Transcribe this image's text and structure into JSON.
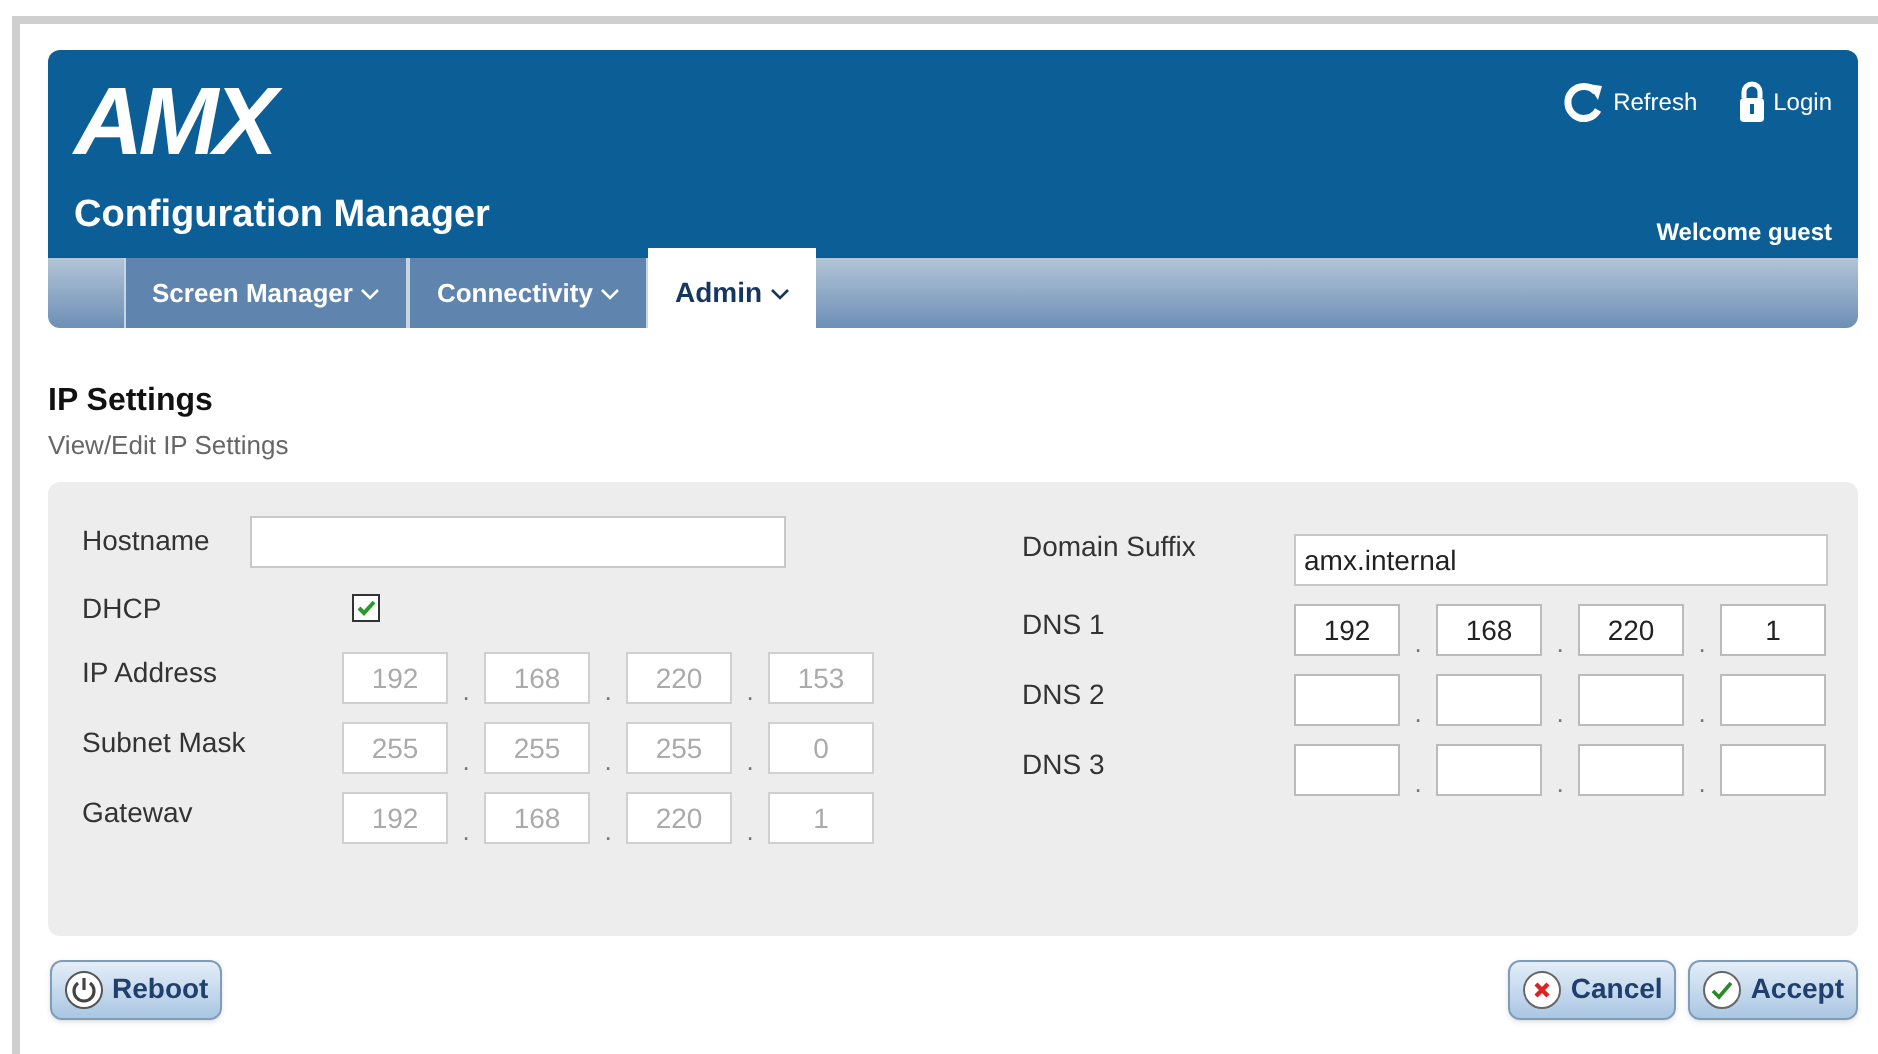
{
  "header": {
    "logo": "AMX",
    "title": "Configuration Manager",
    "actions": [
      {
        "kind": "refresh",
        "label": "Refresh"
      },
      {
        "kind": "login",
        "label": "Login"
      }
    ],
    "welcome": "Welcome guest"
  },
  "tabs": [
    {
      "label": "Screen Manager",
      "selected": false
    },
    {
      "label": "Connectivity",
      "selected": false
    },
    {
      "label": "Admin",
      "selected": true
    }
  ],
  "page": {
    "title": "IP Settings",
    "subtitle": "View/Edit IP Settings"
  },
  "left": {
    "hostname": {
      "label": "Hostname"
    },
    "dhcp": {
      "label": "DHCP",
      "checked": true
    },
    "rows": [
      {
        "label": "IP Address",
        "disabled": true,
        "octets": [
          "192",
          "168",
          "220",
          "153"
        ],
        "separators": [
          ".",
          ".",
          "."
        ]
      },
      {
        "label": "Subnet Mask",
        "disabled": true,
        "octets": [
          "255",
          "255",
          "255",
          "0"
        ],
        "separators": [
          ".",
          ".",
          "."
        ]
      },
      {
        "label": "Gatewav",
        "disabled": true,
        "octets": [
          "192",
          "168",
          "220",
          "1"
        ],
        "separators": [
          ".",
          ".",
          "."
        ]
      }
    ]
  },
  "right": {
    "domain": {
      "label": "Domain Suffix",
      "value": "amx.internal"
    },
    "rows": [
      {
        "label": "DNS 1",
        "disabled": false,
        "octets": [
          "192",
          "168",
          "220",
          "1"
        ],
        "separators": [
          ".",
          ".",
          "."
        ]
      },
      {
        "label": "DNS 2",
        "disabled": false,
        "separators": [
          ".",
          ".",
          "."
        ]
      },
      {
        "label": "DNS 3",
        "disabled": false,
        "separators": [
          ".",
          ".",
          "."
        ]
      }
    ]
  },
  "buttons": [
    {
      "kind": "reboot",
      "label": "Reboot"
    },
    {
      "kind": "cancel",
      "label": "Cancel"
    },
    {
      "kind": "accept",
      "label": "Accept"
    }
  ]
}
